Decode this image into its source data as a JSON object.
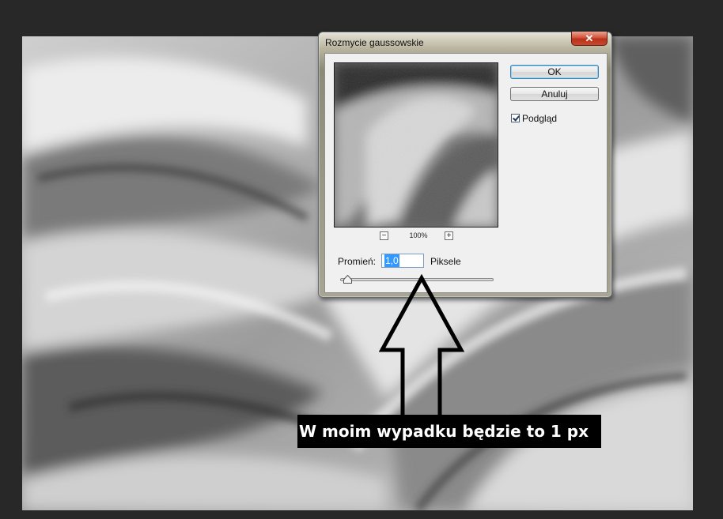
{
  "dialog": {
    "title": "Rozmycie gaussowskie",
    "close_label": "✕",
    "ok_label": "OK",
    "cancel_label": "Anuluj",
    "preview_checkbox_label": "Podgląd",
    "preview_checked": true,
    "zoom_out_label": "−",
    "zoom_in_label": "+",
    "zoom_level": "100%",
    "radius_label": "Promień:",
    "radius_value": "1,0",
    "unit_label": "Piksele"
  },
  "annotation": {
    "caption": "W moim wypadku będzie to 1 px"
  },
  "colors": {
    "background": "#282828",
    "caption_background": "#000000",
    "caption_text": "#ffffff",
    "selection": "#3399ff"
  }
}
